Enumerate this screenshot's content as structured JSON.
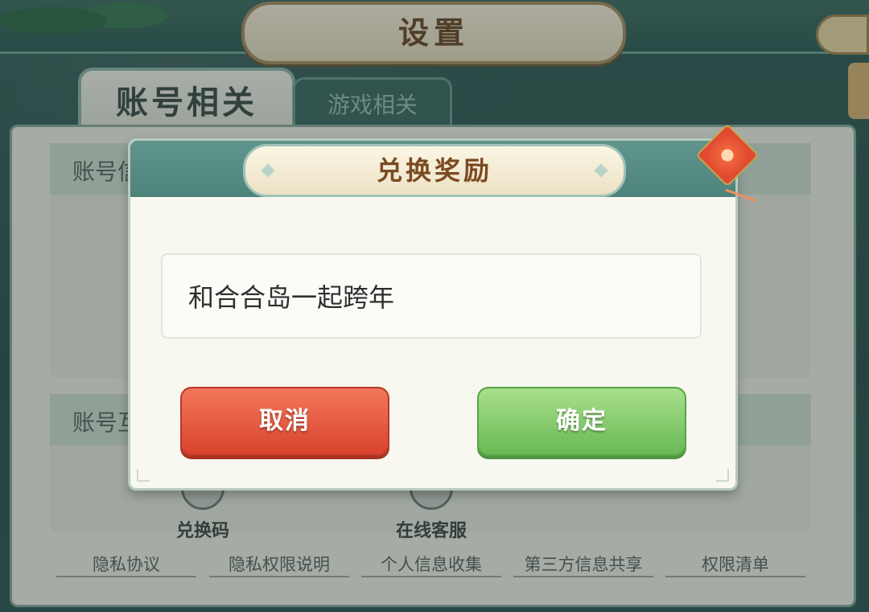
{
  "header": {
    "title": "设置"
  },
  "tabs": [
    {
      "label": "账号相关",
      "active": true
    },
    {
      "label": "游戏相关",
      "active": false
    }
  ],
  "sections": [
    {
      "header": "账号信息"
    },
    {
      "header": "账号互通"
    }
  ],
  "bottom_entries": [
    {
      "label": "兑换码",
      "icon": "redeem-icon"
    },
    {
      "label": "在线客服",
      "icon": "customer-service-icon"
    }
  ],
  "links": [
    "隐私协议",
    "隐私权限说明",
    "个人信息收集",
    "第三方信息共享",
    "权限清单"
  ],
  "dialog": {
    "title": "兑换奖励",
    "input_value": "和合合岛一起跨年",
    "cancel_label": "取消",
    "confirm_label": "确定"
  },
  "colors": {
    "accent": "#4d837a",
    "cancel": "#d9432e",
    "confirm": "#68b955",
    "title_text": "#7a4a22"
  }
}
